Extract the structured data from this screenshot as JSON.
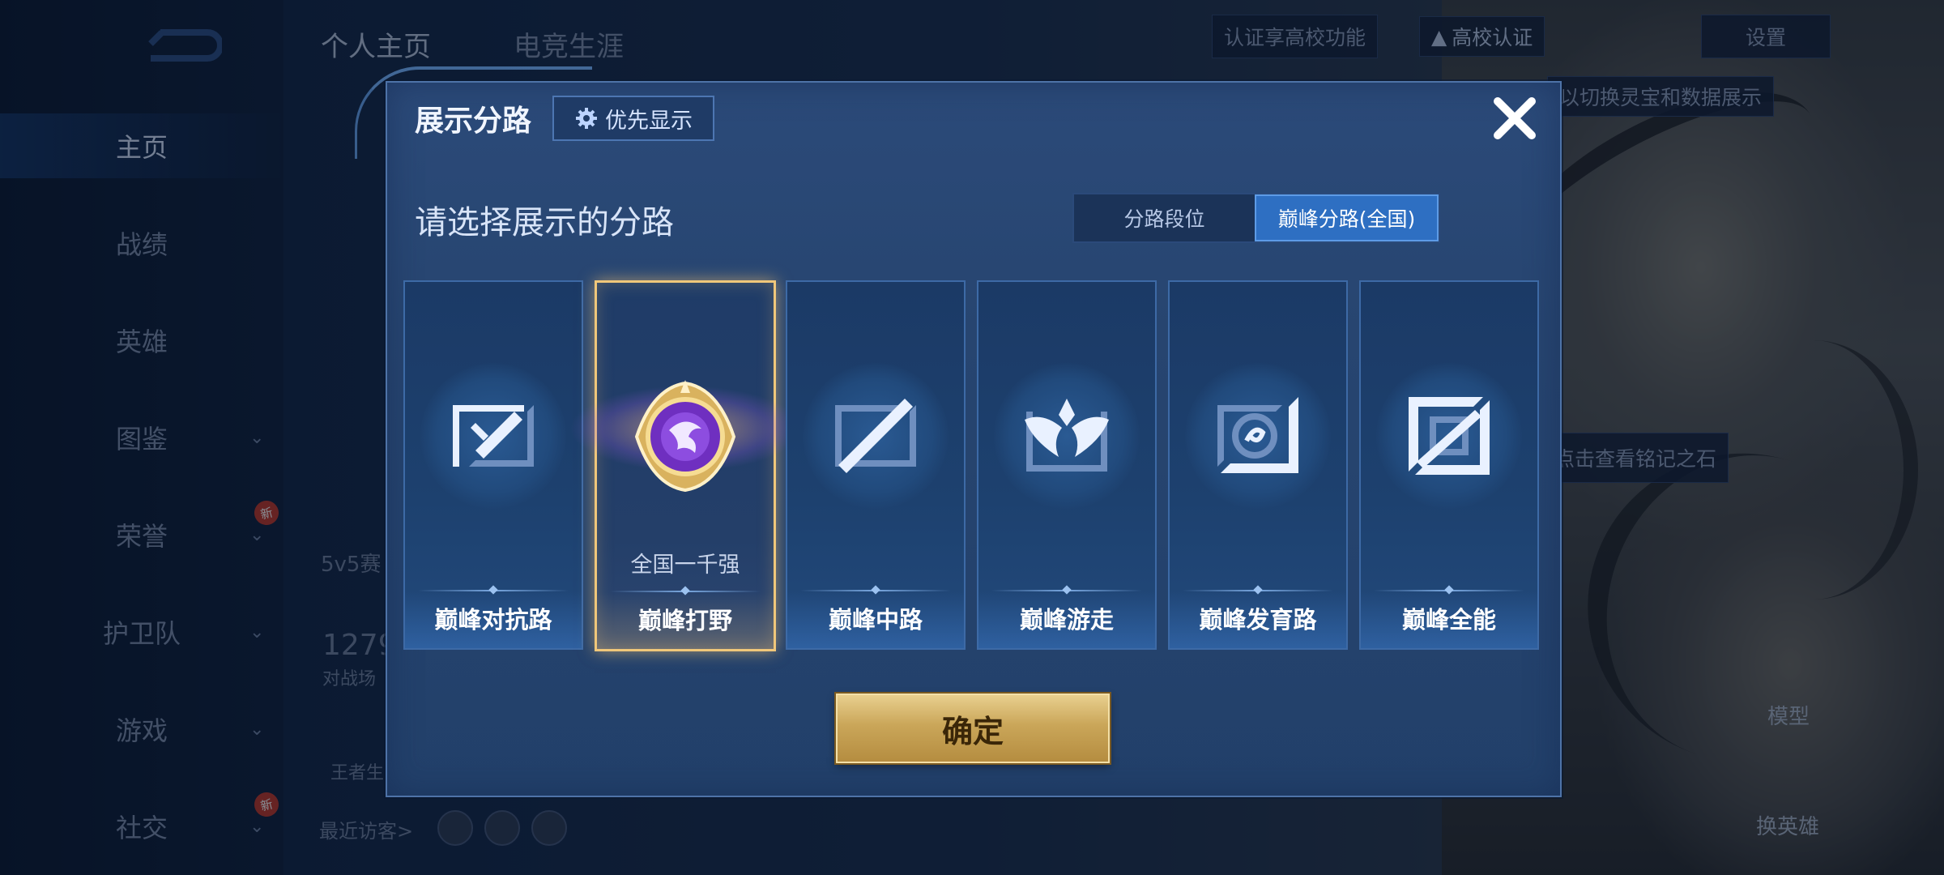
{
  "sidebar": {
    "items": [
      {
        "label": "主页",
        "active": true,
        "chevron": false,
        "new": false
      },
      {
        "label": "战绩",
        "active": false,
        "chevron": false,
        "new": false
      },
      {
        "label": "英雄",
        "active": false,
        "chevron": false,
        "new": false
      },
      {
        "label": "图鉴",
        "active": false,
        "chevron": true,
        "new": false
      },
      {
        "label": "荣誉",
        "active": false,
        "chevron": true,
        "new": true
      },
      {
        "label": "护卫队",
        "active": false,
        "chevron": true,
        "new": false
      },
      {
        "label": "游戏",
        "active": false,
        "chevron": true,
        "new": false
      },
      {
        "label": "社交",
        "active": false,
        "chevron": true,
        "new": true
      }
    ],
    "new_badge": "新"
  },
  "top_tabs": [
    "个人主页",
    "电竞生涯"
  ],
  "header": {
    "verify_text": "认证享高校功能",
    "college_badge": "高校认证",
    "settings": "设置",
    "switch_hint": "以切换灵宝和数据展示"
  },
  "background": {
    "mode_text": "5v5赛",
    "stat_number": "1279",
    "stat_label": "对战场",
    "king_text": "王者生",
    "recent_visitors": "最近访客>",
    "inscription_hint": "点击查看铭记之石",
    "model_label": "模型",
    "switch_hero_label": "换英雄"
  },
  "modal": {
    "title": "展示分路",
    "priority_label": "优先显示",
    "subtitle": "请选择展示的分路",
    "segments": [
      {
        "label": "分路段位",
        "selected": false
      },
      {
        "label": "巅峰分路(全国)",
        "selected": true
      }
    ],
    "cards": [
      {
        "label": "巅峰对抗路",
        "icon": "clash-lane-icon",
        "selected": false,
        "rank": ""
      },
      {
        "label": "巅峰打野",
        "icon": "jungle-badge-icon",
        "selected": true,
        "rank": "全国一千强"
      },
      {
        "label": "巅峰中路",
        "icon": "mid-lane-icon",
        "selected": false,
        "rank": ""
      },
      {
        "label": "巅峰游走",
        "icon": "roam-wings-icon",
        "selected": false,
        "rank": ""
      },
      {
        "label": "巅峰发育路",
        "icon": "farm-lane-icon",
        "selected": false,
        "rank": ""
      },
      {
        "label": "巅峰全能",
        "icon": "all-round-icon",
        "selected": false,
        "rank": ""
      }
    ],
    "confirm_label": "确定"
  },
  "colors": {
    "accent_blue": "#2e6fc2",
    "gold": "#caa659",
    "selected_border": "#f0c77a",
    "modal_bg": "#274570"
  }
}
